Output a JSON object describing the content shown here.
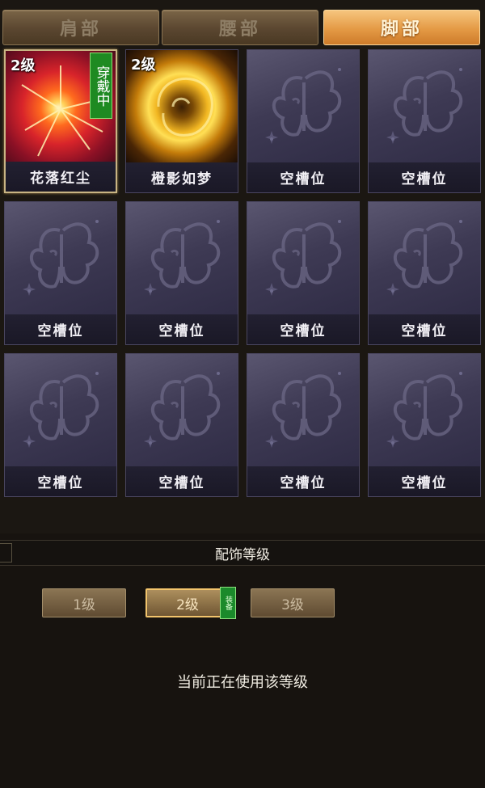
{
  "tabs": [
    {
      "label": "肩部",
      "active": false
    },
    {
      "label": "腰部",
      "active": false
    },
    {
      "label": "脚部",
      "active": true
    }
  ],
  "slots": [
    {
      "name": "花落红尘",
      "level": "2级",
      "badge": "穿戴中",
      "type": "red-burst",
      "selected": true
    },
    {
      "name": "橙影如梦",
      "level": "2级",
      "badge": "",
      "type": "gold-flame",
      "selected": false
    },
    {
      "name": "空槽位",
      "type": "empty"
    },
    {
      "name": "空槽位",
      "type": "empty"
    },
    {
      "name": "空槽位",
      "type": "empty"
    },
    {
      "name": "空槽位",
      "type": "empty"
    },
    {
      "name": "空槽位",
      "type": "empty"
    },
    {
      "name": "空槽位",
      "type": "empty"
    },
    {
      "name": "空槽位",
      "type": "empty"
    },
    {
      "name": "空槽位",
      "type": "empty"
    },
    {
      "name": "空槽位",
      "type": "empty"
    },
    {
      "name": "空槽位",
      "type": "empty"
    }
  ],
  "section": {
    "title": "配饰等级"
  },
  "levels": [
    {
      "label": "1级",
      "current": false
    },
    {
      "label": "2级",
      "current": true,
      "tag": "装备"
    },
    {
      "label": "3级",
      "current": false
    }
  ],
  "status_text": "当前正在使用该等级",
  "colors": {
    "active_tab": "#e49a45",
    "equip_badge": "#1e8a22",
    "slot_bg": "#3e3a54"
  }
}
